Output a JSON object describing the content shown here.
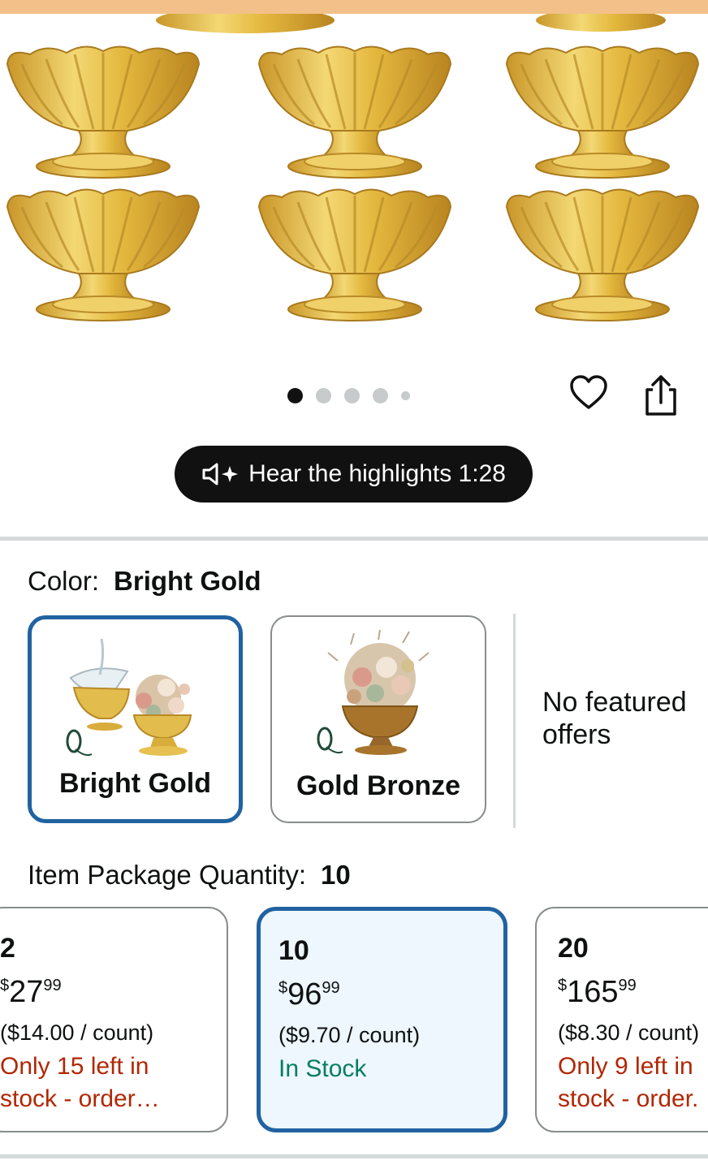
{
  "audio": {
    "icon": "speaker-sparkle-icon",
    "label": "Hear the highlights 1:28"
  },
  "gallery": {
    "image_count": 5,
    "active_index": 0
  },
  "actions": {
    "favorite_icon": "heart-icon",
    "share_icon": "share-icon"
  },
  "color": {
    "label": "Color:",
    "selected": "Bright Gold",
    "options": [
      {
        "name": "Bright Gold",
        "selected": true
      },
      {
        "name": "Gold Bronze",
        "selected": false
      }
    ],
    "no_offers_text": "No featured offers"
  },
  "package": {
    "label": "Item Package Quantity:",
    "selected": "10",
    "options": [
      {
        "qty": "2",
        "currency": "$",
        "dollars": "27",
        "cents": "99",
        "unit": "($14.00 / count)",
        "avail_line1": "Only 15 left in",
        "avail_line2": "stock - order…",
        "status": "low"
      },
      {
        "qty": "10",
        "currency": "$",
        "dollars": "96",
        "cents": "99",
        "unit": "($9.70 / count)",
        "avail_line1": "In Stock",
        "avail_line2": "",
        "status": "in"
      },
      {
        "qty": "20",
        "currency": "$",
        "dollars": "165",
        "cents": "99",
        "unit": "($8.30 / count)",
        "avail_line1": "Only 9 left in",
        "avail_line2": "stock - order.",
        "status": "low"
      }
    ]
  },
  "colors": {
    "accent": "#2162a1",
    "price_red": "#b12704",
    "stock_green": "#067d62",
    "selected_bg": "#edf7fd"
  }
}
